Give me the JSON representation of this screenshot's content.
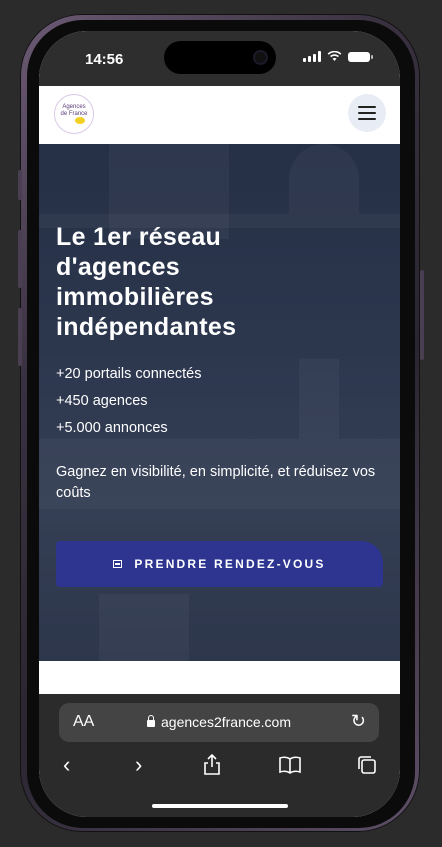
{
  "status_bar": {
    "time": "14:56"
  },
  "site_header": {
    "logo_text_line1": "Agences",
    "logo_text_line2": "de France"
  },
  "hero": {
    "title_lines": [
      "Le 1er réseau",
      "d'agences",
      "immobilières",
      "indépendantes"
    ],
    "stats": [
      "+20 portails connectés",
      "+450 agences",
      "+5.000 annonces"
    ],
    "tagline": "Gagnez en visibilité, en simplicité, et réduisez vos coûts",
    "cta_label": "PRENDRE RENDEZ-VOUS"
  },
  "browser": {
    "text_size_label": "AA",
    "url": "agences2france.com",
    "reload_icon": "reload-icon",
    "toolbar_icons": [
      "back-icon",
      "forward-icon",
      "share-icon",
      "bookmarks-icon",
      "tabs-icon"
    ]
  },
  "colors": {
    "cta_background": "#2d3590",
    "hero_overlay": "#2f3a52",
    "browser_chrome": "#2b2b2b"
  }
}
